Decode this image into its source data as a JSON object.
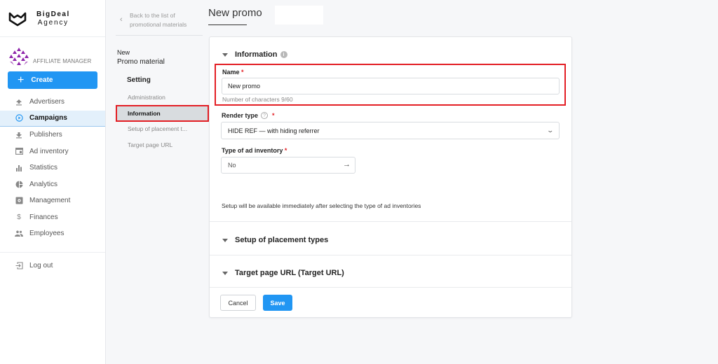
{
  "brand": {
    "line1": "BigDeal",
    "line2": "Agency"
  },
  "role": {
    "label": "AFFILIATE MANAGER"
  },
  "sidebar": {
    "create_label": "Create",
    "items": [
      {
        "label": "Advertisers",
        "icon": "upload-icon",
        "active": false
      },
      {
        "label": "Campaigns",
        "icon": "play-circle-icon",
        "active": true
      },
      {
        "label": "Publishers",
        "icon": "download-icon",
        "active": false
      },
      {
        "label": "Ad inventory",
        "icon": "browser-window-icon",
        "active": false
      },
      {
        "label": "Statistics",
        "icon": "bar-chart-icon",
        "active": false
      },
      {
        "label": "Analytics",
        "icon": "pie-chart-icon",
        "active": false
      },
      {
        "label": "Management",
        "icon": "settings-box-icon",
        "active": false
      },
      {
        "label": "Finances",
        "icon": "dollar-icon",
        "active": false
      },
      {
        "label": "Employees",
        "icon": "people-icon",
        "active": false
      }
    ],
    "logout_label": "Log out"
  },
  "subnav": {
    "back_line1": "Back to the list of",
    "back_line2": "promotional materials",
    "title_small": "New",
    "title": "Promo material",
    "heading": "Setting",
    "items": [
      {
        "label": "Administration",
        "active": false
      },
      {
        "label": "Information",
        "active": true
      },
      {
        "label": "Setup of placement t...",
        "active": false
      },
      {
        "label": "Target page URL",
        "active": false
      }
    ]
  },
  "main": {
    "page_title": "New promo",
    "info_section": "Information",
    "name_label": "Name",
    "name_value": "New promo",
    "name_hint": "Number of characters 9/60",
    "render_label": "Render type",
    "render_value": "HIDE REF — with hiding referrer",
    "inventory_label": "Type of ad inventory",
    "inventory_value": "No",
    "setup_note": "Setup will be available immediately after selecting the type of ad inventories",
    "placement_section": "Setup of placement types",
    "target_section": "Target page URL (Target URL)",
    "cancel_label": "Cancel",
    "save_label": "Save",
    "required_mark": "*"
  },
  "colors": {
    "accent": "#2196f3",
    "highlight": "#e31e24",
    "role_icon": "#8e24aa"
  }
}
